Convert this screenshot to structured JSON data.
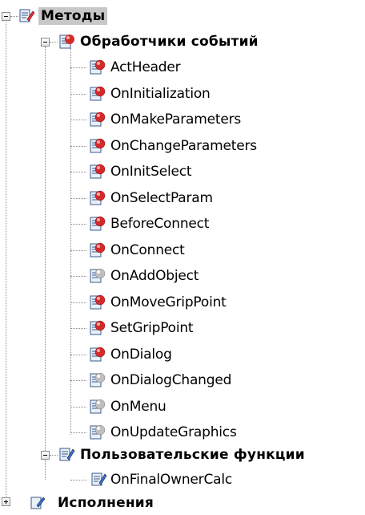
{
  "tree": {
    "root": {
      "label": "Методы",
      "icon": "methods-folder-icon"
    },
    "event_handlers": {
      "label": "Обработчики событий",
      "icon": "event-handlers-icon",
      "items": [
        {
          "label": "ActHeader",
          "icon": "red-method-icon"
        },
        {
          "label": "OnInitialization",
          "icon": "red-method-icon"
        },
        {
          "label": "OnMakeParameters",
          "icon": "red-method-icon"
        },
        {
          "label": "OnChangeParameters",
          "icon": "red-method-icon"
        },
        {
          "label": "OnInitSelect",
          "icon": "red-method-icon"
        },
        {
          "label": "OnSelectParam",
          "icon": "red-method-icon"
        },
        {
          "label": "BeforeConnect",
          "icon": "red-method-icon"
        },
        {
          "label": "OnConnect",
          "icon": "red-method-icon"
        },
        {
          "label": "OnAddObject",
          "icon": "gray-method-icon"
        },
        {
          "label": "OnMoveGripPoint",
          "icon": "red-method-icon"
        },
        {
          "label": "SetGripPoint",
          "icon": "red-method-icon"
        },
        {
          "label": "OnDialog",
          "icon": "red-method-icon"
        },
        {
          "label": "OnDialogChanged",
          "icon": "gray-method-icon"
        },
        {
          "label": "OnMenu",
          "icon": "gray-method-icon"
        },
        {
          "label": "OnUpdateGraphics",
          "icon": "gray-method-icon"
        }
      ]
    },
    "user_functions": {
      "label": "Пользовательские функции",
      "icon": "user-functions-icon",
      "items": [
        {
          "label": "OnFinalOwnerCalc",
          "icon": "user-function-icon"
        }
      ]
    },
    "next_node": {
      "label": "Исполнения",
      "icon": "executions-icon"
    }
  },
  "colors": {
    "red_ball": "#d42a2a",
    "gray_ball": "#bfbfbf",
    "selection": "#c8c8c8",
    "tree_line": "#8a8a8a"
  }
}
